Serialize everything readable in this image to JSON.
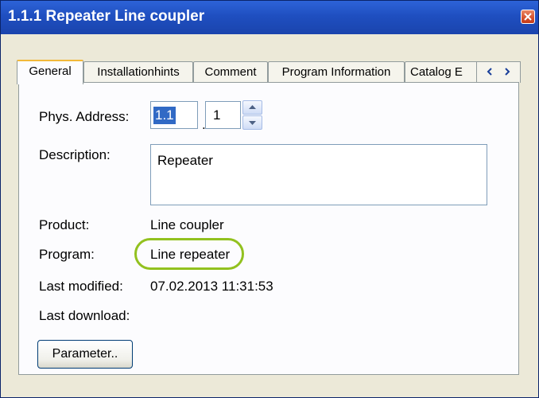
{
  "window": {
    "title": "1.1.1 Repeater Line coupler"
  },
  "tabs": [
    {
      "label": "General"
    },
    {
      "label": "Installationhints"
    },
    {
      "label": "Comment"
    },
    {
      "label": "Program Information"
    },
    {
      "label": "Catalog E"
    }
  ],
  "form": {
    "phys_address_label": "Phys. Address:",
    "phys_address_part1": "1.1",
    "phys_address_separator": ".",
    "phys_address_part2": "1",
    "description_label": "Description:",
    "description_value": "Repeater",
    "product_label": "Product:",
    "product_value": "Line coupler",
    "program_label": "Program:",
    "program_value": "Line repeater",
    "last_modified_label": "Last modified:",
    "last_modified_value": "07.02.2013 11:31:53",
    "last_download_label": "Last download:",
    "last_download_value": ""
  },
  "buttons": {
    "parameter_label": "Parameter.."
  },
  "icons": {
    "close": "close-icon",
    "tab_prev": "chevron-left-icon",
    "tab_next": "chevron-right-icon",
    "spin_up": "arrow-up-icon",
    "spin_down": "arrow-down-icon"
  },
  "colors": {
    "titlebar": "#1f4fc0",
    "highlight_ring": "#92c11f",
    "selection": "#316ac5",
    "active_tab_accent": "#f2b93a"
  }
}
